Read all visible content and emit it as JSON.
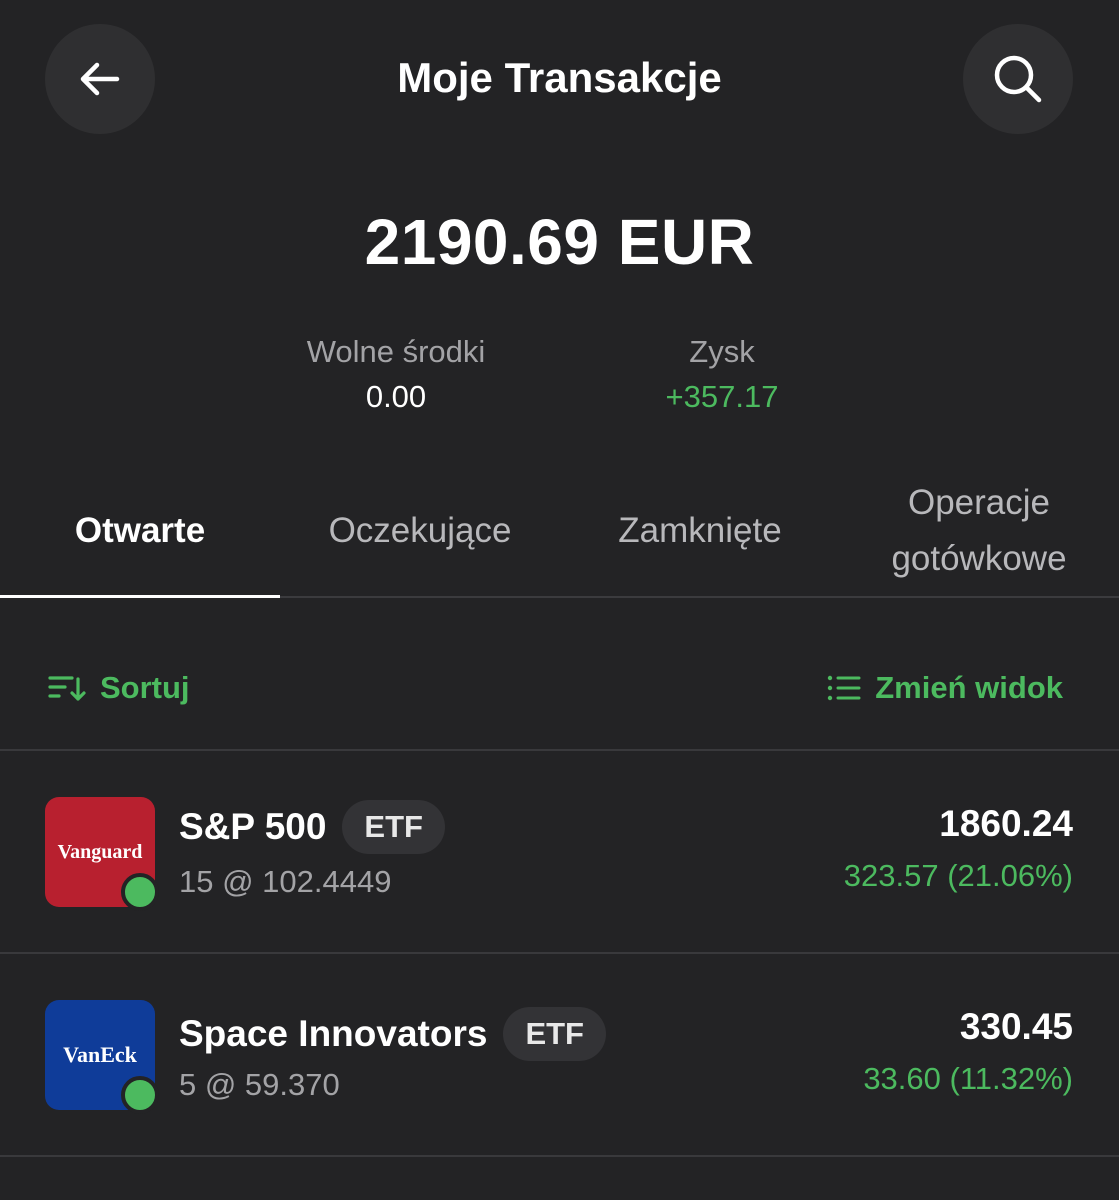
{
  "header": {
    "title": "Moje Transakcje"
  },
  "summary": {
    "balance": "2190.69 EUR",
    "free_funds_label": "Wolne środki",
    "free_funds_value": "0.00",
    "profit_label": "Zysk",
    "profit_value": "+357.17"
  },
  "tabs": [
    {
      "label": "Otwarte",
      "active": true
    },
    {
      "label": "Oczekujące",
      "active": false
    },
    {
      "label": "Zamknięte",
      "active": false
    },
    {
      "label": "Operacje gotówkowe",
      "active": false
    }
  ],
  "toolbar": {
    "sort_label": "Sortuj",
    "view_label": "Zmień widok"
  },
  "positions": [
    {
      "logo_text": "Vanguard",
      "logo_color": "#b8202f",
      "name": "S&P 500",
      "badge": "ETF",
      "quantity_price": "15 @ 102.4449",
      "value": "1860.24",
      "change": "323.57 (21.06%)"
    },
    {
      "logo_text": "VanEck",
      "logo_color": "#0f3c99",
      "name": "Space Innovators",
      "badge": "ETF",
      "quantity_price": "5 @ 59.370",
      "value": "330.45",
      "change": "33.60 (11.32%)"
    }
  ],
  "colors": {
    "accent_green": "#4cba5f",
    "background": "#232325"
  }
}
